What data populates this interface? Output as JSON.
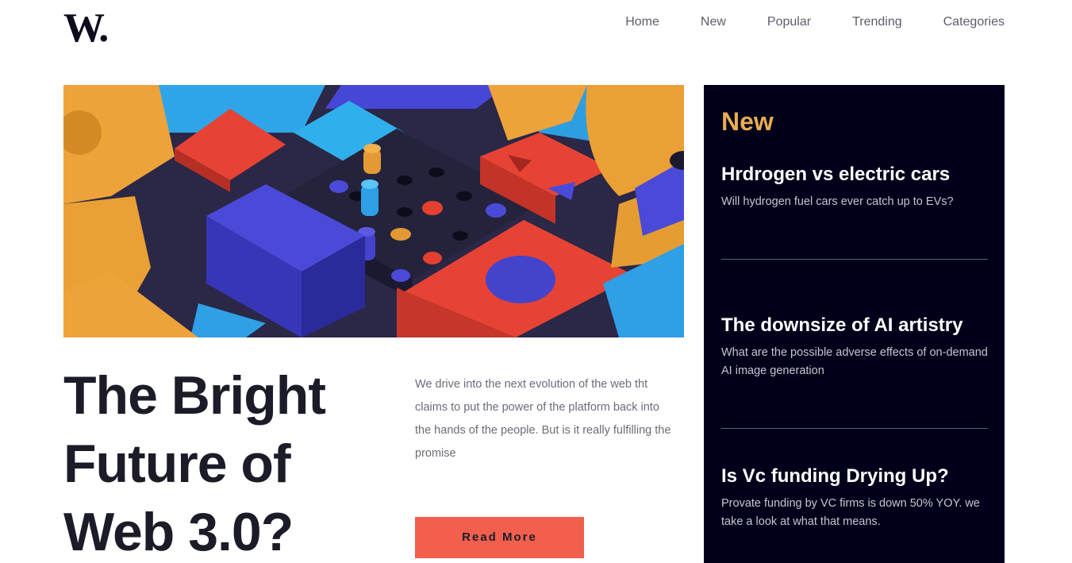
{
  "logo": "W.",
  "nav": [
    "Home",
    "New",
    "Popular",
    "Trending",
    "Categories"
  ],
  "hero": {
    "headline": "The Bright Future of Web 3.0?",
    "blurb": "We drive into the next evolution of the web tht claims to put the power of the platform back into the hands of the people. But is it really fulfilling the promise",
    "cta": "Read More"
  },
  "sidebar": {
    "title": "New",
    "items": [
      {
        "title": "Hrdrogen vs electric cars",
        "desc": "Will hydrogen fuel cars ever catch up to EVs?"
      },
      {
        "title": "The downsize of AI artistry",
        "desc": "What are the possible adverse effects of on-demand AI image generation"
      },
      {
        "title": "Is Vc funding Drying Up?",
        "desc": "Provate funding by VC firms is down 50% YOY. we take a look at what that means."
      }
    ]
  },
  "colors": {
    "accent": "#f25f4c",
    "sidebar_bg": "#00001a",
    "sidebar_title": "#e9ab53",
    "text_dark": "#1b1c28"
  }
}
